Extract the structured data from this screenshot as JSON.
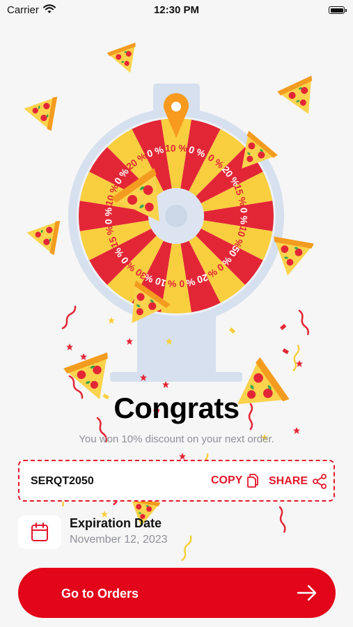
{
  "status_bar": {
    "carrier": "Carrier",
    "time": "12:30 PM"
  },
  "wheel": {
    "segment_labels": [
      "10 %",
      "0 %",
      "0 %",
      "20 %",
      "15 %",
      "0 %",
      "10 %",
      "50 %",
      "0 %",
      "20 %",
      "0 %",
      "10 %",
      "30 %",
      "0 %",
      "15 %",
      "0 %",
      "10 %",
      "0 %",
      "20 %",
      "0 %"
    ],
    "colors": {
      "red": "#e32636",
      "yellow": "#f9cf40",
      "stand": "#d6e0ee",
      "pointer": "#f79a1d"
    }
  },
  "result": {
    "headline": "Congrats",
    "message": "You won 10% discount on your next order."
  },
  "coupon": {
    "code": "SERQT2050",
    "copy_label": "COPY",
    "share_label": "SHARE"
  },
  "expiration": {
    "title": "Expiration Date",
    "date": "November 12, 2023"
  },
  "primary_action": {
    "label": "Go to Orders"
  },
  "theme": {
    "accent": "#e30519",
    "text_muted": "#8f9099",
    "background": "#f6f6f6"
  }
}
